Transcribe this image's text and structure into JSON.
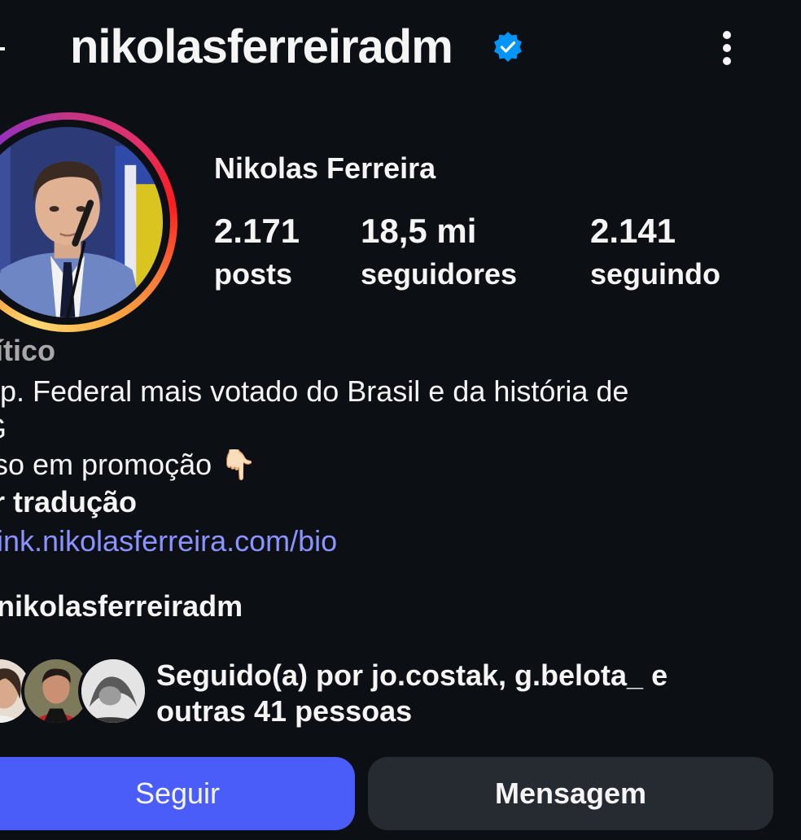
{
  "header": {
    "username": "nikolasferreiradm",
    "verified_color": "#0095f6"
  },
  "profile": {
    "full_name": "Nikolas Ferreira",
    "stats": [
      {
        "value": "2.171",
        "label": "posts"
      },
      {
        "value": "18,5 mi",
        "label": "seguidores"
      },
      {
        "value": "2.141",
        "label": "seguindo"
      }
    ]
  },
  "bio": {
    "category": "lítico",
    "line1": "ep. Federal mais votado do Brasil e da história de",
    "line2": "G",
    "line3": "rso em promoção",
    "line3_emoji": "👇🏻",
    "translate": "r tradução",
    "link": "link.nikolasferreira.com/bio",
    "threads_handle": "nikolasferreiradm"
  },
  "followed_by": {
    "text": "Seguido(a) por jo.costak, g.belota_ e outras 41 pessoas"
  },
  "actions": {
    "follow_label": "Seguir",
    "message_label": "Mensagem",
    "follow_color": "#4a5df9"
  }
}
